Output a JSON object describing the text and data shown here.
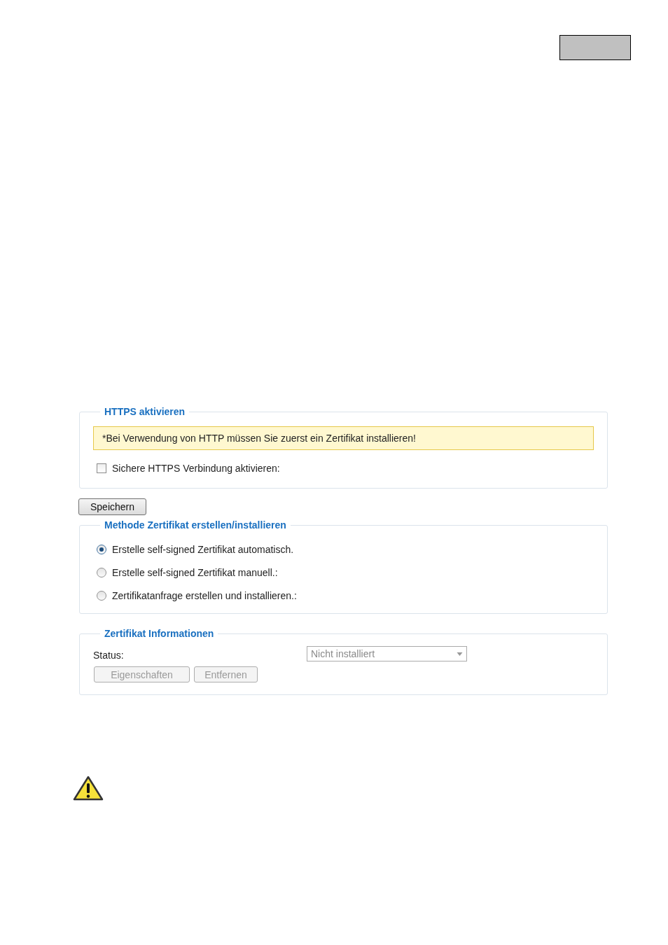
{
  "https_panel": {
    "legend": "HTTPS aktivieren",
    "notice": "*Bei Verwendung von HTTP müssen Sie zuerst ein Zertifikat installieren!",
    "checkbox": {
      "label": "Sichere HTTPS Verbindung aktivieren:",
      "checked": false
    }
  },
  "save_button": {
    "label": "Speichern",
    "disabled": false
  },
  "method_panel": {
    "legend": "Methode Zertifikat erstellen/installieren",
    "options": [
      {
        "label": "Erstelle self-signed Zertifikat automatisch.",
        "selected": true
      },
      {
        "label": "Erstelle self-signed Zertifikat manuell.:",
        "selected": false
      },
      {
        "label": "Zertifikatanfrage erstellen und installieren.:",
        "selected": false
      }
    ]
  },
  "info_panel": {
    "legend": "Zertifikat Informationen",
    "status_label": "Status:",
    "status_select": {
      "value": "Nicht installiert",
      "disabled": true
    },
    "buttons": [
      {
        "label": "Eigenschaften",
        "disabled": true
      },
      {
        "label": "Entfernen",
        "disabled": true
      }
    ]
  }
}
